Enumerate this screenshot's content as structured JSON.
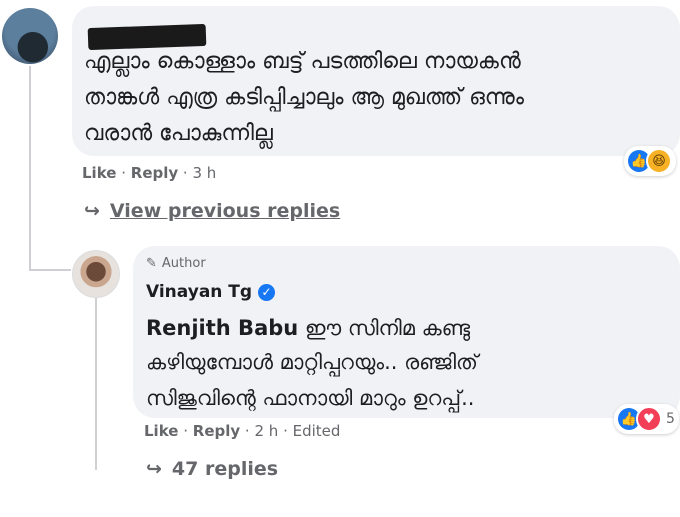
{
  "comment1": {
    "text_lines": [
      "എല്ലാം കൊള്ളാം ബട്ട് പടത്തിലെ നായകൻ",
      "താങ്കൾ എത്ര കടിപ്പിച്ചാലും ആ മുഖത്ത് ഒന്നും",
      "വരാൻ പോകുന്നില്ല"
    ],
    "like_label": "Like",
    "reply_label": "Reply",
    "time": "3 h"
  },
  "view_previous_replies": "View previous replies",
  "comment2": {
    "author_badge": "Author",
    "author_name": "Vinayan Tg",
    "mention": "Renjith Babu",
    "text_line1_rest": " ഈ സിനിമ കണ്ടു",
    "text_line2": "കഴിയുമ്പോൾ മാറ്റിപ്പറയും.. രഞ്ജിത്",
    "text_line3": "സിജുവിന്റെ ഫാനായി മാറും ഉറപ്പ്..",
    "like_label": "Like",
    "reply_label": "Reply",
    "time": "2 h",
    "edited": "Edited",
    "reaction_count": "5"
  },
  "replies_count_label": "47 replies",
  "colors": {
    "bubble": "#f0f2f5",
    "meta": "#65676b",
    "like_blue": "#1877f2"
  }
}
